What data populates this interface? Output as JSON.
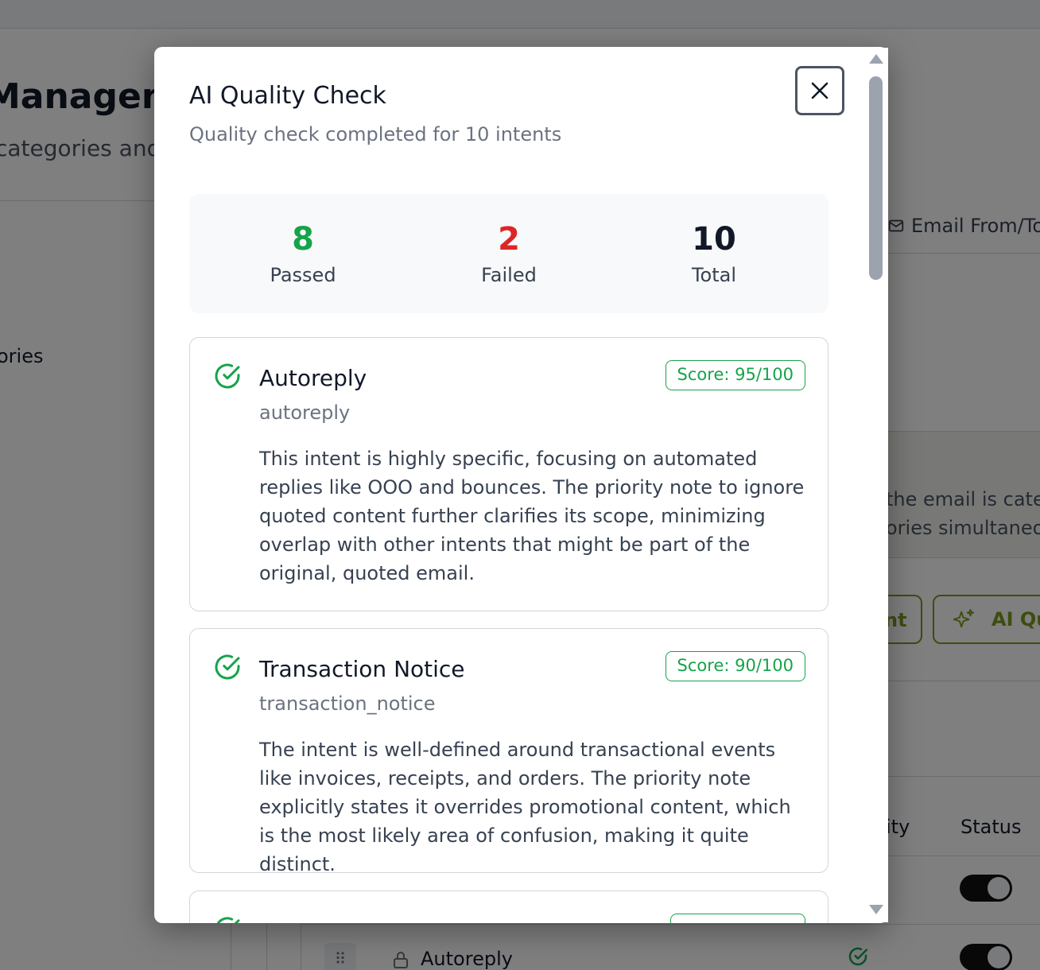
{
  "background": {
    "page_title": "Managem",
    "page_subtitle": "categories and",
    "sidebar_categories": "ories",
    "email_tab_label": "Email From/To",
    "info_line_1": "the email is categ",
    "info_line_2": "ories simultaneo",
    "partial_button_label": "nt",
    "ai_button_label": "AI Qu",
    "table_headers": {
      "priority": "ity",
      "status": "Status"
    },
    "row": {
      "name": "Autoreply"
    }
  },
  "modal": {
    "title": "AI Quality Check",
    "description": "Quality check completed for 10 intents",
    "close_label": "Close",
    "stats": {
      "passed": {
        "value": "8",
        "label": "Passed"
      },
      "failed": {
        "value": "2",
        "label": "Failed"
      },
      "total": {
        "value": "10",
        "label": "Total"
      }
    },
    "results": [
      {
        "name": "Autoreply",
        "id": "autoreply",
        "score": "Score: 95/100",
        "status": "passed",
        "reason": "This intent is highly specific, focusing on automated replies like OOO and bounces. The priority note to ignore quoted content further clarifies its scope, minimizing overlap with other intents that might be part of the original, quoted email."
      },
      {
        "name": "Transaction Notice",
        "id": "transaction_notice",
        "score": "Score: 90/100",
        "status": "passed",
        "reason": "The intent is well-defined around transactional events like invoices, receipts, and orders. The priority note explicitly states it overrides promotional content, which is the most likely area of confusion, making it quite distinct."
      },
      {
        "name": "",
        "id": "",
        "score": "",
        "status": "passed",
        "reason": ""
      }
    ]
  },
  "colors": {
    "passed": "#16a34a",
    "failed": "#dc2626",
    "accent_olive": "#7a9a1e",
    "overlay": "rgba(0,0,0,0.5)"
  },
  "icons": {
    "close": "close-icon",
    "passed": "check-circle-icon",
    "email": "mail-icon",
    "ai": "sparkles-icon",
    "lock": "lock-icon",
    "drag": "drag-handle-icon"
  }
}
